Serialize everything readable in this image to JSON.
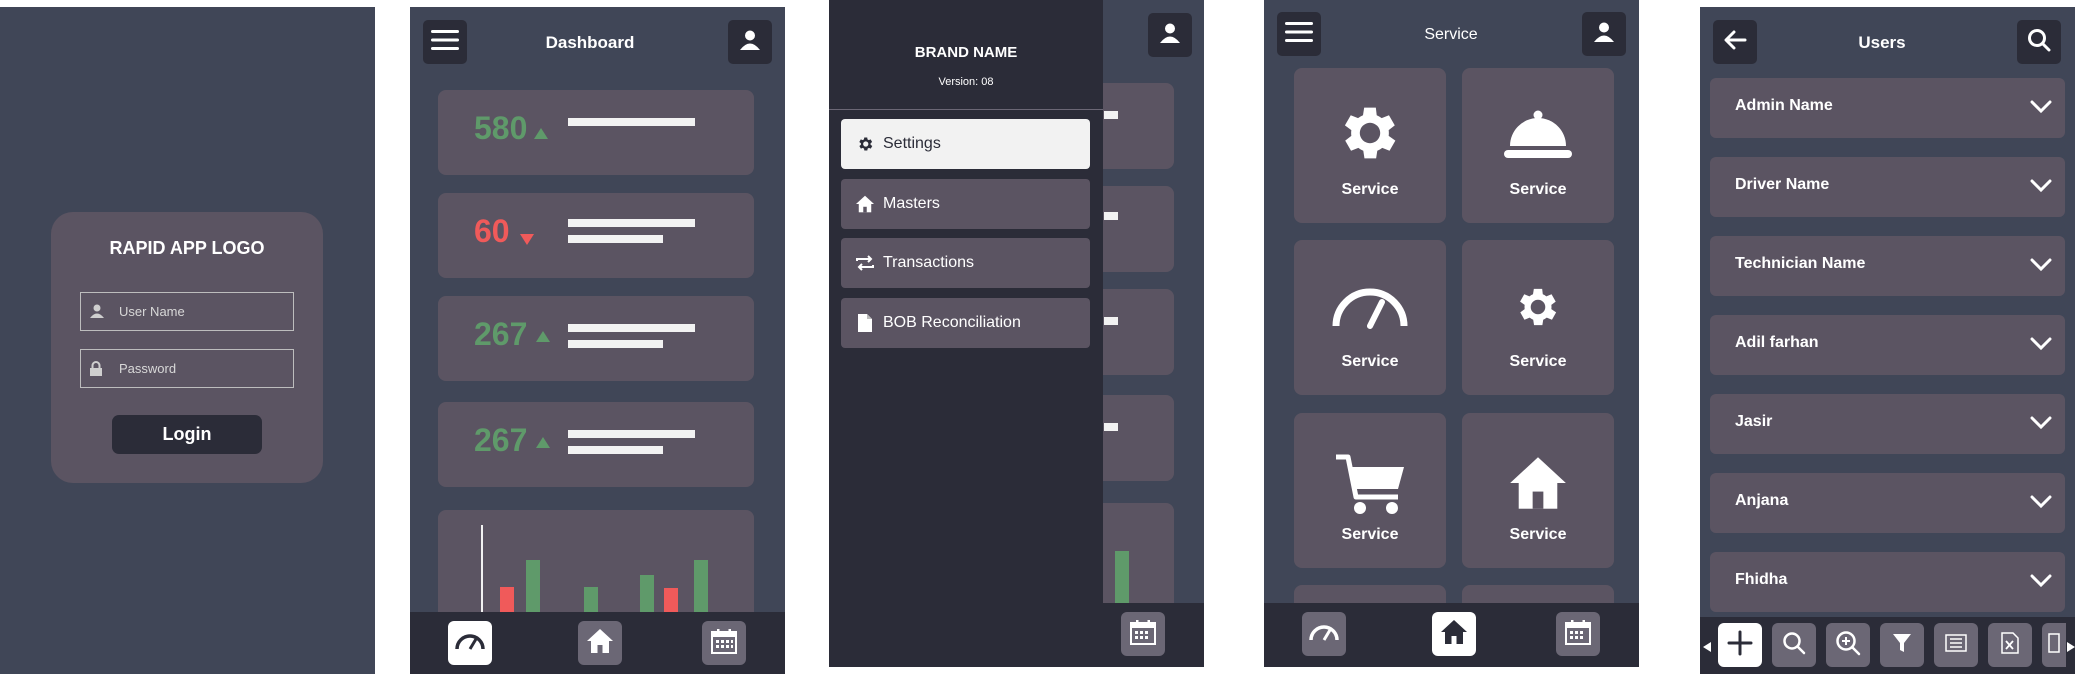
{
  "login": {
    "logo": "RAPID APP LOGO",
    "username_placeholder": "User Name",
    "password_placeholder": "Password",
    "login_label": "Login"
  },
  "dashboard": {
    "title": "Dashboard",
    "stats": [
      {
        "value": "580",
        "trend": "up",
        "color": "#5f9a6a"
      },
      {
        "value": "60",
        "trend": "down",
        "color": "#f05a5a"
      },
      {
        "value": "267",
        "trend": "up",
        "color": "#5f9a6a"
      },
      {
        "value": "267",
        "trend": "up",
        "color": "#5f9a6a"
      }
    ],
    "nav": [
      "gauge-icon",
      "home-icon",
      "calendar-icon"
    ]
  },
  "drawer": {
    "brand": "BRAND NAME",
    "version": "Version: 08",
    "items": [
      {
        "label": "Settings",
        "icon": "gear-icon",
        "active": true
      },
      {
        "label": "Masters",
        "icon": "home-icon",
        "active": false
      },
      {
        "label": "Transactions",
        "icon": "transfer-icon",
        "active": false
      },
      {
        "label": "BOB Reconciliation",
        "icon": "document-icon",
        "active": false
      }
    ]
  },
  "service": {
    "title": "Service",
    "tiles": [
      {
        "label": "Service",
        "icon": "gear-icon"
      },
      {
        "label": "Service",
        "icon": "service-bell-icon"
      },
      {
        "label": "Service",
        "icon": "gauge-icon"
      },
      {
        "label": "Service",
        "icon": "gear-icon"
      },
      {
        "label": "Service",
        "icon": "cart-icon"
      },
      {
        "label": "Service",
        "icon": "home-icon"
      }
    ]
  },
  "users": {
    "title": "Users",
    "rows": [
      "Admin Name",
      "Driver Name",
      "Technician Name",
      "Adil farhan",
      "Jasir",
      "Anjana",
      "Fhidha"
    ],
    "toolbar": [
      "add-icon",
      "search-icon",
      "zoom-in-icon",
      "filter-icon",
      "list-icon",
      "excel-icon"
    ]
  },
  "colors": {
    "background": "#404657",
    "card": "#5b5462",
    "dark": "#2b2c38",
    "up": "#5f9a6a",
    "down": "#f05a5a"
  }
}
